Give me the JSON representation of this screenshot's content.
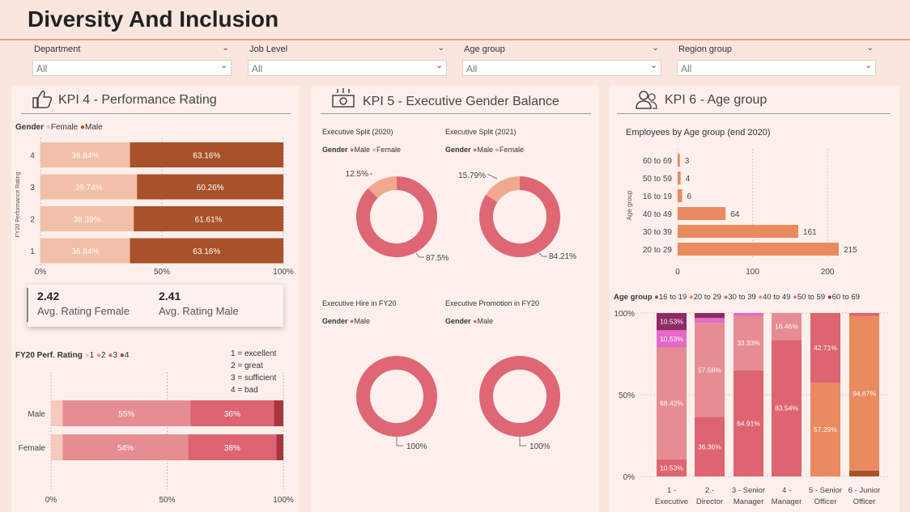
{
  "header": {
    "title": "Diversity And Inclusion"
  },
  "filters": [
    {
      "label": "Department",
      "value": "All"
    },
    {
      "label": "Job Level",
      "value": "All"
    },
    {
      "label": "Age group",
      "value": "All"
    },
    {
      "label": "Region group",
      "value": "All"
    }
  ],
  "kpi4": {
    "title": "KPI 4 - Performance Rating",
    "legend_label": "Gender",
    "legend": [
      "Female",
      "Male"
    ],
    "axis_title": "FY20 Performance Rating",
    "card": {
      "female_value": "2.42",
      "female_label": "Avg. Rating Female",
      "male_value": "2.41",
      "male_label": "Avg. Rating Male"
    },
    "perf_legend_label": "FY20 Perf. Rating",
    "perf_legend": [
      "1",
      "2",
      "3",
      "4"
    ],
    "notes": [
      "1 = excellent",
      "2 = great",
      "3 = sufficient",
      "4 = bad"
    ]
  },
  "kpi5": {
    "title": "KPI 5 - Executive Gender Balance",
    "legend_label": "Gender",
    "male": "Male",
    "female": "Female"
  },
  "kpi6": {
    "title": "KPI 6 - Age group",
    "chart_title": "Employees by Age group (end 2020)",
    "stack_legend_label": "Age group"
  },
  "colors": {
    "female": "#f2bfa8",
    "male": "#a8512b",
    "r1": "#f5c9bc",
    "r2": "#e58d92",
    "r3": "#dd6470",
    "r4": "#a93540",
    "donut_male": "#de6773",
    "donut_female": "#f0a98e",
    "age_bar": "#ea8a5f",
    "a16": "#a8512b",
    "a20": "#ea8a5f",
    "a30": "#dd6470",
    "a40": "#e58d92",
    "a50": "#e56ac7",
    "a60": "#8e2b66"
  },
  "chart_data": [
    {
      "type": "bar",
      "title": "",
      "ylabel": "FY20 Performance Rating",
      "categories": [
        "4",
        "3",
        "2",
        "1"
      ],
      "series": [
        {
          "name": "Female",
          "values": [
            36.84,
            39.74,
            38.39,
            36.84
          ]
        },
        {
          "name": "Male",
          "values": [
            63.16,
            60.26,
            61.61,
            63.16
          ]
        }
      ],
      "xticks": [
        "0%",
        "50%",
        "100%"
      ],
      "xlim": [
        0,
        100
      ]
    },
    {
      "type": "bar",
      "title": "",
      "categories": [
        "Male",
        "Female"
      ],
      "series": [
        {
          "name": "1",
          "values": [
            5,
            5
          ]
        },
        {
          "name": "2",
          "values": [
            55,
            54
          ]
        },
        {
          "name": "3",
          "values": [
            36,
            38
          ]
        },
        {
          "name": "4",
          "values": [
            4,
            3
          ]
        }
      ],
      "xticks": [
        "0%",
        "50%",
        "100%"
      ],
      "xlim": [
        0,
        100
      ]
    },
    {
      "type": "pie",
      "title": "Executive Split (2020)",
      "labels": [
        "Male",
        "Female"
      ],
      "values": [
        87.5,
        12.5
      ],
      "value_labels": [
        "87.5%",
        "12.5%"
      ]
    },
    {
      "type": "pie",
      "title": "Executive Split (2021)",
      "labels": [
        "Male",
        "Female"
      ],
      "values": [
        84.21,
        15.79
      ],
      "value_labels": [
        "84.21%",
        "15.79%"
      ]
    },
    {
      "type": "pie",
      "title": "Executive Hire in FY20",
      "labels": [
        "Male"
      ],
      "values": [
        100
      ],
      "value_labels": [
        "100%"
      ]
    },
    {
      "type": "pie",
      "title": "Executive Promotion in FY20",
      "labels": [
        "Male"
      ],
      "values": [
        100
      ],
      "value_labels": [
        "100%"
      ]
    },
    {
      "type": "bar",
      "title": "Employees by Age group (end 2020)",
      "ylabel": "Age group",
      "categories": [
        "60 to 69",
        "50 to 59",
        "16 to 19",
        "40 to 49",
        "30 to 39",
        "20 to 29"
      ],
      "values": [
        3,
        4,
        6,
        64,
        161,
        215
      ],
      "xticks": [
        "0",
        "100",
        "200"
      ],
      "xlim": [
        0,
        215
      ]
    },
    {
      "type": "bar",
      "title": "",
      "categories": [
        "1 - Executive",
        "2 - Director",
        "3 - Senior Manager",
        "4 - Manager",
        "5 - Senior Officer",
        "6 - Junior Officer"
      ],
      "series": [
        {
          "name": "16 to 19",
          "values": [
            0,
            0,
            0,
            0,
            0,
            3.5
          ]
        },
        {
          "name": "20 to 29",
          "values": [
            0,
            0,
            0,
            0,
            57.29,
            94.67
          ]
        },
        {
          "name": "30 to 39",
          "values": [
            10.53,
            36.36,
            64.91,
            83.54,
            42.71,
            1.83
          ]
        },
        {
          "name": "40 to 49",
          "values": [
            68.42,
            57.58,
            33.33,
            16.46,
            0,
            0
          ]
        },
        {
          "name": "50 to 59",
          "values": [
            10.53,
            3.03,
            1.76,
            0,
            0,
            0
          ]
        },
        {
          "name": "60 to 69",
          "values": [
            10.53,
            3.03,
            0,
            0,
            0,
            0
          ]
        }
      ],
      "data_labels": {
        "1 - Executive": [
          "10.53%",
          "68.42%",
          "10.53%",
          "10.53%"
        ],
        "2 - Director": [
          "36.36%",
          "57.58%"
        ],
        "3 - Senior Manager": [
          "64.91%",
          "33.33%"
        ],
        "4 - Manager": [
          "83.54%",
          "16.46%"
        ],
        "5 - Senior Officer": [
          "57.29%",
          "42.71%"
        ],
        "6 - Junior Officer": [
          "94.67%"
        ]
      },
      "yticks": [
        "0%",
        "50%",
        "100%"
      ],
      "ylim": [
        0,
        100
      ]
    }
  ]
}
